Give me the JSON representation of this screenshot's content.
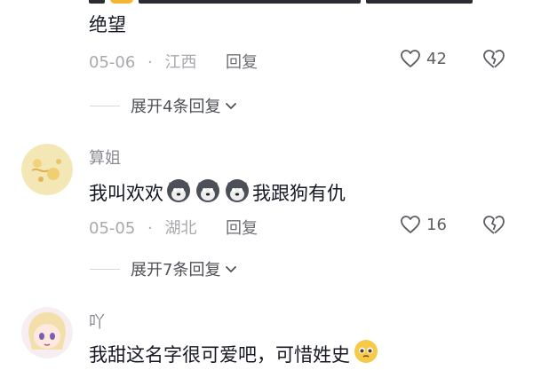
{
  "comment_prev": {
    "text_line2": "绝望",
    "date": "05-06",
    "location": "江西",
    "reply_label": "回复",
    "likes": "42",
    "expand_label": "展开4条回复"
  },
  "comment_1": {
    "username": "算姐",
    "text_before": "我叫欢欢",
    "text_after": "我跟狗有仇",
    "emoji_icon": "husky-dog-emoji-icon",
    "date": "05-05",
    "location": "湖北",
    "reply_label": "回复",
    "likes": "16",
    "expand_label": "展开7条回复"
  },
  "comment_2": {
    "username": "吖",
    "text": "我甜这名字很可爱吧，可惜姓史"
  },
  "colors": {
    "text_primary": "#161823",
    "text_meta": "#a8a9ad",
    "divider": "#d7d8db"
  }
}
